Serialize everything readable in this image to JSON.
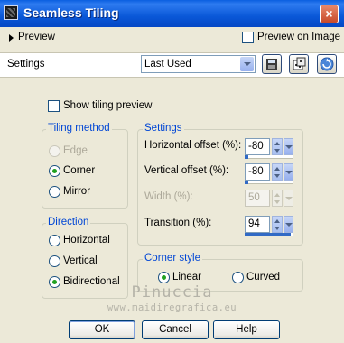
{
  "window": {
    "title": "Seamless Tiling",
    "close_glyph": "×"
  },
  "preview_bar": {
    "label": "Preview",
    "preview_on_image_label": "Preview on Image",
    "preview_on_image_checked": false
  },
  "settings_bar": {
    "label": "Settings",
    "preset_value": "Last Used",
    "icons": [
      "save-preset-icon",
      "random-dice-icon",
      "reset-icon"
    ]
  },
  "show_tiling_preview": {
    "label": "Show tiling preview",
    "checked": false
  },
  "tiling_method": {
    "title": "Tiling method",
    "options": [
      {
        "label": "Edge",
        "selected": false,
        "disabled": true
      },
      {
        "label": "Corner",
        "selected": true,
        "disabled": false
      },
      {
        "label": "Mirror",
        "selected": false,
        "disabled": false
      }
    ]
  },
  "direction": {
    "title": "Direction",
    "options": [
      {
        "label": "Horizontal",
        "selected": false
      },
      {
        "label": "Vertical",
        "selected": false
      },
      {
        "label": "Bidirectional",
        "selected": true
      }
    ]
  },
  "settings": {
    "title": "Settings",
    "horizontal_offset": {
      "label": "Horizontal offset (%):",
      "value": "-80"
    },
    "vertical_offset": {
      "label": "Vertical offset (%):",
      "value": "-80"
    },
    "width": {
      "label": "Width (%):",
      "value": "50",
      "disabled": true
    },
    "transition": {
      "label": "Transition (%):",
      "value": "94"
    }
  },
  "corner_style": {
    "title": "Corner style",
    "options": [
      {
        "label": "Linear",
        "selected": true
      },
      {
        "label": "Curved",
        "selected": false
      }
    ]
  },
  "watermark": {
    "name": "Pinuccia",
    "url": "www.maidiregrafica.eu"
  },
  "buttons": {
    "ok": "OK",
    "cancel": "Cancel",
    "help": "Help"
  }
}
